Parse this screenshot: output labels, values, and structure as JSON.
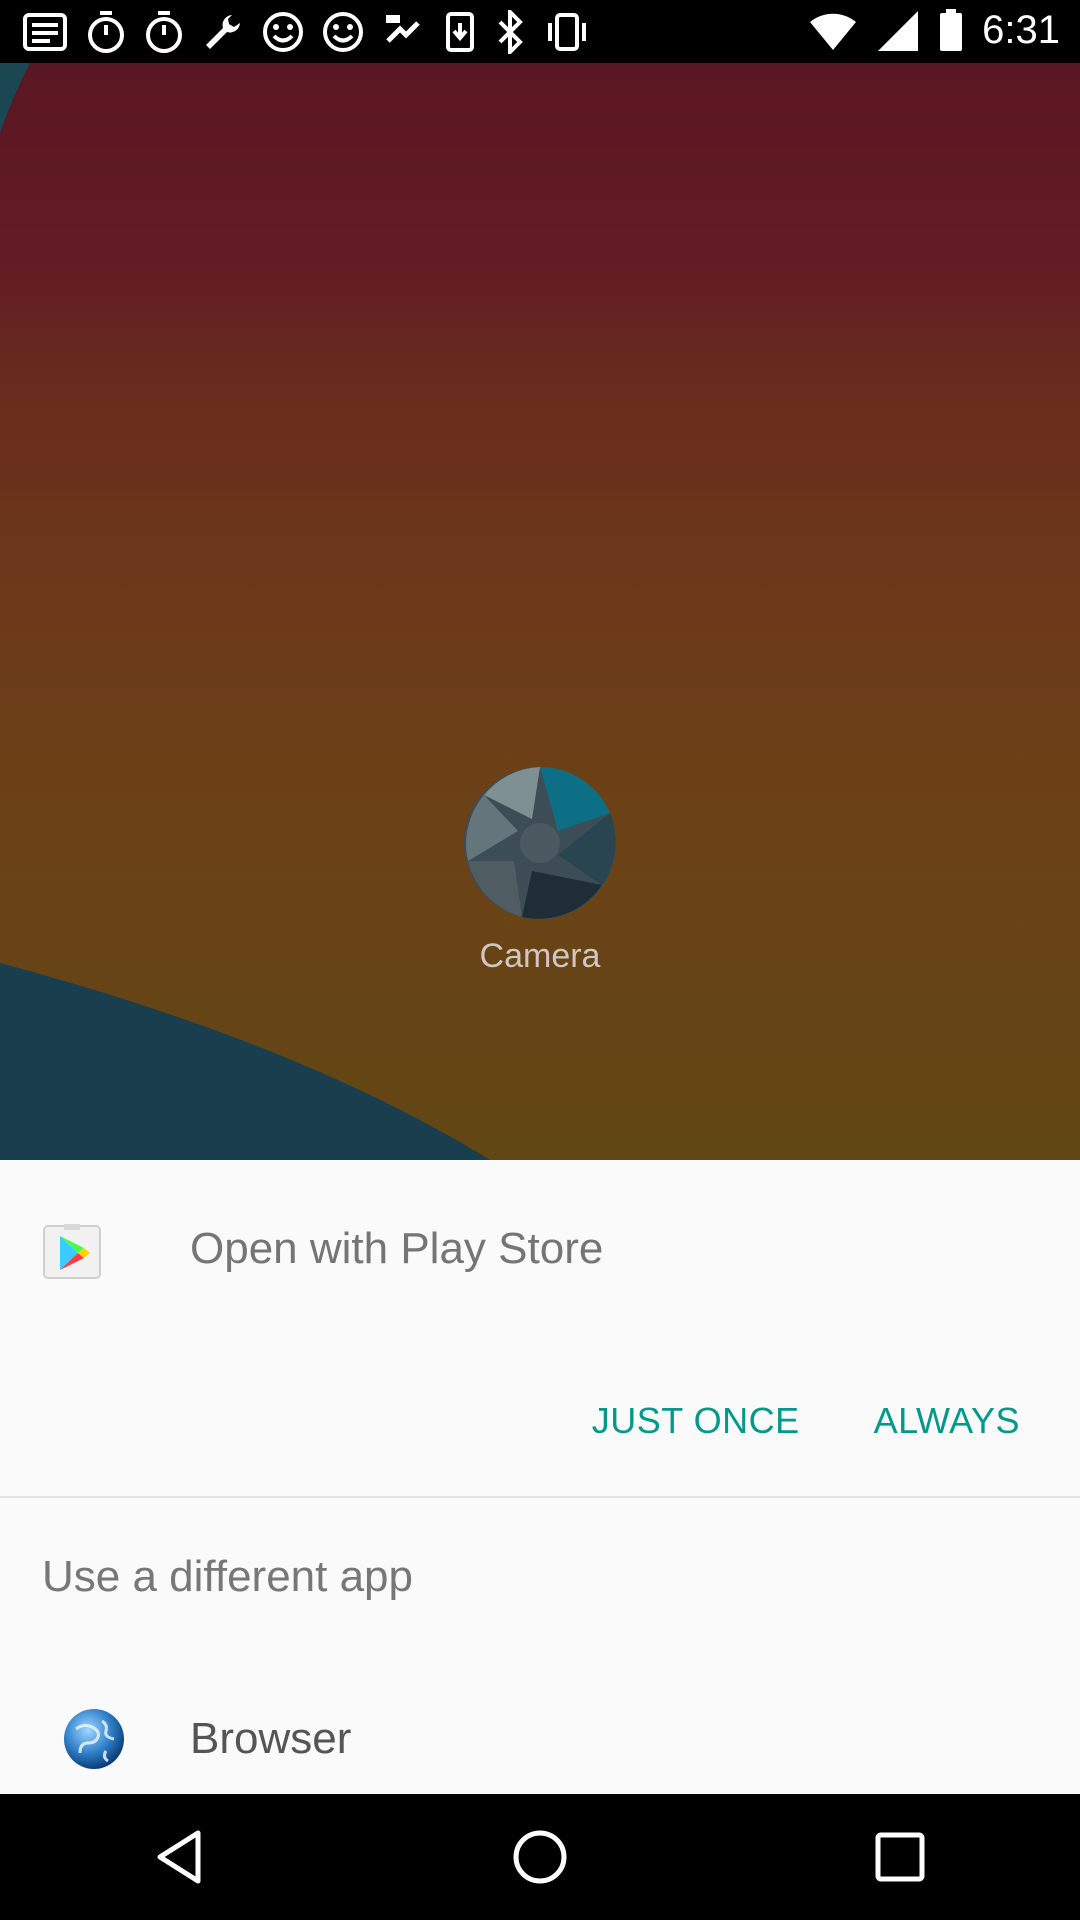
{
  "status_bar": {
    "time": "6:31",
    "left_icons": [
      "notification-icon",
      "stopwatch-icon",
      "stopwatch-icon",
      "wrench-icon",
      "smiley-icon",
      "smiley-icon",
      "fake-gps-icon",
      "download-icon",
      "bluetooth-icon",
      "vibrate-icon"
    ],
    "right_icons": [
      "wifi-icon",
      "signal-icon",
      "battery-icon"
    ]
  },
  "home": {
    "camera_label": "Camera"
  },
  "dialog": {
    "title": "Open with Play Store",
    "just_once_label": "JUST ONCE",
    "always_label": "ALWAYS",
    "alt_title": "Use a different app",
    "apps": [
      {
        "label": "Browser",
        "icon": "globe-icon"
      }
    ]
  },
  "nav": {
    "back": "back-icon",
    "home": "home-icon",
    "recents": "recents-icon"
  },
  "colors": {
    "accent": "#03998a",
    "sheet_bg": "#fafafa"
  }
}
